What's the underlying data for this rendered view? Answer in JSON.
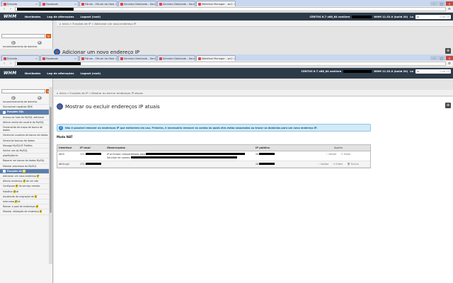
{
  "browser": {
    "tabs": [
      {
        "label": "Entrada -",
        "active": false
      },
      {
        "label": "Facebook",
        "active": false
      },
      {
        "label": "Fórum - Fórum do Host",
        "active": false
      },
      {
        "label": "Servidor Dedicado - Serv",
        "active": false
      },
      {
        "label": "Servidor Dedicado - Serv",
        "active": false
      },
      {
        "label": "WebHost Manager - wc2",
        "active": true
      }
    ],
    "back_tabs": [
      {
        "label": "Entrada",
        "active": false
      },
      {
        "label": "Facebook",
        "active": false
      },
      {
        "label": "Fórum - Fórum do Host",
        "active": false
      },
      {
        "label": "Servidor Dedicado - Serv",
        "active": false
      },
      {
        "label": "Servidor Dedicado - Serv",
        "active": false
      },
      {
        "label": "WebHost Manager - wc2",
        "active": true
      }
    ],
    "find_text": "ip",
    "find_count": "0 de 10"
  },
  "whm": {
    "logo": "WHM",
    "nav": [
      "Novidades",
      "Log de alterações",
      "Logout (root)"
    ],
    "os": "CENTOS 6.7 x86_64 xenlivre",
    "version": "WHM 11.52.0 (build 20)",
    "extra": "Lo"
  },
  "back": {
    "breadcrumb": "⌂ Início » Funções de IP » Adicionar um novo endereço IP",
    "title": "Adicionar um novo endereço IP",
    "sidebar_label": "encaminhamento de domínio"
  },
  "breadcrumb": "⌂ Início » Funções de IP » Mostrar ou excluir endereços IP atuais",
  "page_title": "Mostrar ou excluir endereços IP atuais",
  "info_text": "Não é possível remover os endereços IP que estiverem em uso. Primeiro, é necessário remover as contas às quais eles estão associados ou trocar os domínios para um novo endereço IP.",
  "mode_label": "Modo NAT",
  "table": {
    "headers": [
      "Interface",
      "IP local",
      "Observações",
      "IP público",
      "Ações"
    ],
    "rows": [
      {
        "iface": "eth0",
        "ip": "172.",
        "note1": "IP principal; compartilhado para",
        "note2": "Servidor de nomes:",
        "pub": "54.",
        "validate": "Validar",
        "edit": "Editar"
      },
      {
        "iface": "eth0:cp1",
        "ip": "172.",
        "note1": "",
        "note2": "",
        "pub": "54.",
        "validate": "Validar",
        "edit": "Editar",
        "delete": "Excluir"
      }
    ]
  },
  "sidebar": {
    "items": [
      {
        "label": "encaminhamento de domínio"
      },
      {
        "label": "Sincronizar registros DNS"
      },
      {
        "label": "Funções SQL",
        "section": true
      },
      {
        "label": "Acesso ao host do MySQL adicional"
      },
      {
        "label": "Alterar senha de usuário do MySQL"
      },
      {
        "label": "Ferramenta de mapa de banco de dados"
      },
      {
        "label": "Gerenciar usuários de banco de dados"
      },
      {
        "label": "Gerenciar bancos de dados"
      },
      {
        "label": "Manage MySQL® Profiles"
      },
      {
        "label": "Senha raiz do MySQL"
      },
      {
        "label": "phpMyAdmin"
      },
      {
        "label": "Reparar um banco de dados MySQL"
      },
      {
        "label": "Mostrar processos do MySQL"
      },
      {
        "label": "Funções de IP",
        "section": true,
        "hl": "IP"
      },
      {
        "label": "Adicionar um novo endereço IP",
        "hl": "IP"
      },
      {
        "label": "Alterar endereço IP de um site",
        "hl": "IP"
      },
      {
        "label": "Configurar IP de serviço remoto",
        "hl": "IP"
      },
      {
        "label": "Habilitar IPv6",
        "hl": "IP"
      },
      {
        "label": "Assistente de migração de IP",
        "hl": "IP"
      },
      {
        "label": "Intervalos IPv6",
        "hl": "IP"
      },
      {
        "label": "Reaver o pool de endereços IP",
        "hl": "IP"
      },
      {
        "label": "Mostrar utilização de endereço IP",
        "hl": "IP"
      }
    ]
  }
}
